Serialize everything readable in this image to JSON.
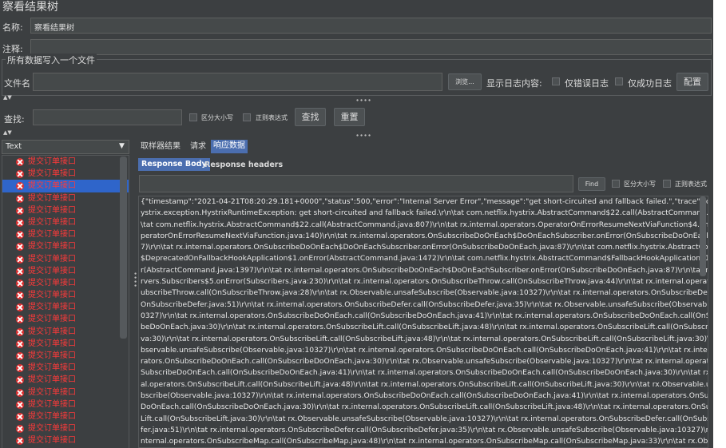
{
  "window": {
    "title": "察看结果树"
  },
  "name_row": {
    "label": "名称:",
    "value": "察看结果树"
  },
  "comment_row": {
    "label": "注释:",
    "value": ""
  },
  "file_group": {
    "title": "所有数据写入一个文件",
    "file_label": "文件名",
    "file_value": "",
    "browse_label": "浏览...",
    "log_content_label": "显示日志内容:",
    "errors_only_label": "仅错误日志",
    "success_only_label": "仅成功日志",
    "configure_label": "配置"
  },
  "search": {
    "label": "查找:",
    "value": "",
    "case_sensitive_label": "区分大小写",
    "regex_label": "正则表达式",
    "find_label": "查找",
    "reset_label": "重置"
  },
  "renderer": {
    "selected": "Text"
  },
  "tree": {
    "selected_index": 2,
    "items": [
      "提交订单接口",
      "提交订单接口",
      "提交订单接口",
      "提交订单接口",
      "提交订单接口",
      "提交订单接口",
      "提交订单接口",
      "提交订单接口",
      "提交订单接口",
      "提交订单接口",
      "提交订单接口",
      "提交订单接口",
      "提交订单接口",
      "提交订单接口",
      "提交订单接口",
      "提交订单接口",
      "提交订单接口",
      "提交订单接口",
      "提交订单接口",
      "提交订单接口",
      "提交订单接口",
      "提交订单接口",
      "提交订单接口",
      "提交订单接口"
    ]
  },
  "tabs": [
    "取样器结果",
    "请求",
    "响应数据"
  ],
  "subtabs": [
    "Response Body",
    "Response headers"
  ],
  "response_search": {
    "value": "",
    "find_label": "Find",
    "case_label": "区分大小写",
    "regex_label": "正则表达式"
  },
  "response_lines": [
    "{\"timestamp\":\"2021-04-21T08:20:29.181+0000\",\"status\":500,\"error\":\"Internal Server Error\",\"message\":\"get short-circuited and fallback failed.\",\"trace\":\"com.netflix.h",
    "ystrix.exception.HystrixRuntimeException: get short-circuited and fallback failed.\\r\\n\\tat com.netflix.hystrix.AbstractCommand$22.call(AbstractCommand.java:832)\\r\\",
    "\\tat com.netflix.hystrix.AbstractCommand$22.call(AbstractCommand.java:807)\\r\\n\\tat rx.internal.operators.OperatorOnErrorResumeNextViaFunction$4.onError(O",
    "peratorOnErrorResumeNextViaFunction.java:140)\\r\\n\\tat rx.internal.operators.OnSubscribeDoOnEach$DoOnEachSubscriber.onError(OnSubscribeDoOnEach.java:",
    "7)\\r\\n\\tat rx.internal.operators.OnSubscribeDoOnEach$DoOnEachSubscriber.onError(OnSubscribeDoOnEach.java:87)\\r\\n\\tat com.netflix.hystrix.AbstractComman",
    "$DeprecatedOnFallbackHookApplication$1.onError(AbstractCommand.java:1472)\\r\\n\\tat com.netflix.hystrix.AbstractCommand$FallbackHookApplication$1.onErr",
    "r(AbstractCommand.java:1397)\\r\\n\\tat rx.internal.operators.OnSubscribeDoOnEach$DoOnEachSubscriber.onError(OnSubscribeDoOnEach.java:87)\\r\\n\\tat rx.obs",
    "rvers.Subscribers$5.onError(Subscribers.java:230)\\r\\n\\tat rx.internal.operators.OnSubscribeThrow.call(OnSubscribeThrow.java:44)\\r\\n\\tat rx.internal.operators.On",
    "ubscribeThrow.call(OnSubscribeThrow.java:28)\\r\\n\\tat rx.Observable.unsafeSubscribe(Observable.java:10327)\\r\\n\\tat rx.internal.operators.OnSubscribeDefer.call",
    "OnSubscribeDefer.java:51)\\r\\n\\tat rx.internal.operators.OnSubscribeDefer.call(OnSubscribeDefer.java:35)\\r\\n\\tat rx.Observable.unsafeSubscribe(Observable.java:1",
    "0327)\\r\\n\\tat rx.internal.operators.OnSubscribeDoOnEach.call(OnSubscribeDoOnEach.java:41)\\r\\n\\tat rx.internal.operators.OnSubscribeDoOnEach.call(OnSubscri",
    "beDoOnEach.java:30)\\r\\n\\tat rx.internal.operators.OnSubscribeLift.call(OnSubscribeLift.java:48)\\r\\n\\tat rx.internal.operators.OnSubscribeLift.call(OnSubscribeLift.j",
    "va:30)\\r\\n\\tat rx.internal.operators.OnSubscribeLift.call(OnSubscribeLift.java:48)\\r\\n\\tat rx.internal.operators.OnSubscribeLift.call(OnSubscribeLift.java:30)\\r\\n\\tat rx.O",
    "bservable.unsafeSubscribe(Observable.java:10327)\\r\\n\\tat rx.internal.operators.OnSubscribeDoOnEach.call(OnSubscribeDoOnEach.java:41)\\r\\n\\tat rx.internal.op",
    "rators.OnSubscribeDoOnEach.call(OnSubscribeDoOnEach.java:30)\\r\\n\\tat rx.Observable.unsafeSubscribe(Observable.java:10327)\\r\\n\\tat rx.internal.operators.On",
    "SubscribeDoOnEach.call(OnSubscribeDoOnEach.java:41)\\r\\n\\tat rx.internal.operators.OnSubscribeDoOnEach.call(OnSubscribeDoOnEach.java:30)\\r\\n\\tat rx.inte",
    "al.operators.OnSubscribeLift.call(OnSubscribeLift.java:48)\\r\\n\\tat rx.internal.operators.OnSubscribeLift.call(OnSubscribeLift.java:30)\\r\\n\\tat rx.Observable.unsafeS",
    "bscribe(Observable.java:10327)\\r\\n\\tat rx.internal.operators.OnSubscribeDoOnEach.call(OnSubscribeDoOnEach.java:41)\\r\\n\\tat rx.internal.operators.OnSubscrib",
    "DoOnEach.call(OnSubscribeDoOnEach.java:30)\\r\\n\\tat rx.internal.operators.OnSubscribeLift.call(OnSubscribeLift.java:48)\\r\\n\\tat rx.internal.operators.OnSubscribe",
    "Lift.call(OnSubscribeLift.java:30)\\r\\n\\tat rx.Observable.unsafeSubscribe(Observable.java:10327)\\r\\n\\tat rx.internal.operators.OnSubscribeDefer.call(OnSubscribeD",
    "fer.java:51)\\r\\n\\tat rx.internal.operators.OnSubscribeDefer.call(OnSubscribeDefer.java:35)\\r\\n\\tat rx.Observable.unsafeSubscribe(Observable.java:10327)\\r\\n\\tat rx",
    "nternal.operators.OnSubscribeMap.call(OnSubscribeMap.java:48)\\r\\n\\tat rx.internal.operators.OnSubscribeMap.call(OnSubscribeMap.java:33)\\r\\n\\tat rx.Observabl"
  ]
}
